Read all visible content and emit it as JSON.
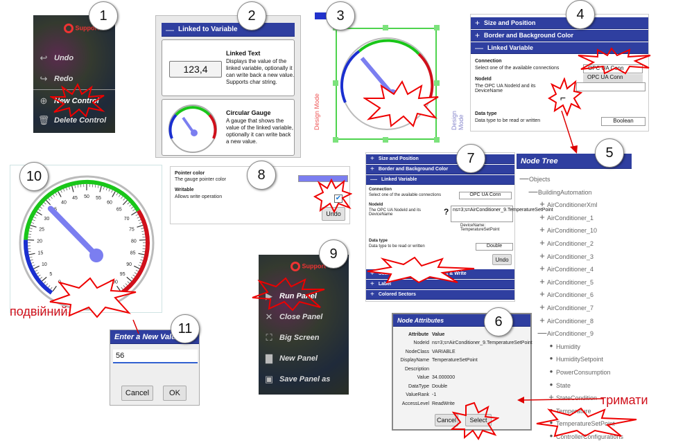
{
  "numbers": [
    "1",
    "2",
    "3",
    "4",
    "5",
    "6",
    "7",
    "8",
    "9",
    "10",
    "11"
  ],
  "panel1": {
    "logo": "Support",
    "items": [
      {
        "label": "Undo",
        "icon": "undo-icon"
      },
      {
        "label": "Redo",
        "icon": "redo-icon"
      },
      {
        "label": "New Control",
        "icon": "add-circle-icon"
      },
      {
        "label": "Delete Control",
        "icon": "trash-icon"
      }
    ]
  },
  "panel2": {
    "header": "Linked to Variable",
    "items": [
      {
        "title": "Linked Text",
        "value": "123,4",
        "desc": "Displays the value of the linked variable, optionally it can write back a new value. Supports char string."
      },
      {
        "title": "Circular Gauge",
        "desc": "A gauge that shows the value of the linked variable, optionally it can write back a new value."
      }
    ]
  },
  "panel3": {
    "side": "Design Mode"
  },
  "panel4": {
    "sections": [
      "Size and Position",
      "Border and Background Color",
      "Linked Variable"
    ],
    "connection_label": "Connection",
    "connection_desc": "Select one of the available connections",
    "connection_value": "OPC UA Conn",
    "connection_opt": "OPC UA Conn",
    "nodeid_label": "NodeId",
    "nodeid_desc": "The OPC UA NodeId and its DeviceName",
    "datatype_label": "Data type",
    "datatype_desc": "Data type to be read or written",
    "datatype_value": "Boolean"
  },
  "panel5": {
    "header": "Node Tree",
    "nodes": [
      "Objects",
      "BuildingAutomation",
      "AirConditionerXml",
      "AirConditioner_1",
      "AirConditioner_10",
      "AirConditioner_2",
      "AirConditioner_3",
      "AirConditioner_4",
      "AirConditioner_5",
      "AirConditioner_6",
      "AirConditioner_7",
      "AirConditioner_8",
      "AirConditioner_9",
      "Humidity",
      "HumiditySetpoint",
      "PowerConsumption",
      "State",
      "StateCondition",
      "Temperature",
      "TemperatureSetPoint",
      "ControllerConfigurations"
    ]
  },
  "panel6": {
    "header": "Node Attributes",
    "col_attr": "Attribute",
    "col_val": "Value",
    "rows": [
      [
        "NodeId",
        "ns=3;s=AirConditioner_9.TemperatureSetPoint"
      ],
      [
        "NodeClass",
        "VARIABLE"
      ],
      [
        "DisplayName",
        "TemperatureSetPoint"
      ],
      [
        "Description",
        ""
      ],
      [
        "Value",
        "34.000000"
      ],
      [
        "DataType",
        "Double"
      ],
      [
        "ValueRank",
        "-1"
      ],
      [
        "AccessLevel",
        "ReadWrite"
      ]
    ],
    "cancel": "Cancel",
    "select": "Select"
  },
  "panel7": {
    "sections": [
      "Size and Position",
      "Border and Background Color",
      "Linked Variable"
    ],
    "connection_label": "Connection",
    "connection_desc": "Select one of the available connections",
    "connection_value": "OPC UA Conn",
    "nodeid_label": "NodeId",
    "nodeid_desc": "The OPC UA NodeId and its DeviceName",
    "nodeid_value": "ns=3;s=AirConditioner_9.TemperatureSetPoint",
    "device_name": "DeviceName: TemperatureSetPoint",
    "datatype_label": "Data type",
    "datatype_desc": "Data type to be read or written",
    "datatype_value": "Double",
    "undo": "Undo",
    "bottom": [
      "Scale Limits, Duration, Aspect & Write",
      "Label",
      "Colored Sectors"
    ]
  },
  "panel8": {
    "pointer_title": "Pointer color",
    "pointer_desc": "The gauge pointer color",
    "writable_title": "Writable",
    "writable_desc": "Allows write operation",
    "undo": "Undo"
  },
  "panel9": {
    "logo": "Support",
    "items": [
      {
        "label": "Run Panel",
        "icon": "play-icon"
      },
      {
        "label": "Close Panel",
        "icon": "close-icon"
      },
      {
        "label": "Big Screen",
        "icon": "fullscreen-icon"
      },
      {
        "label": "New Panel",
        "icon": "document-icon"
      },
      {
        "label": "Save Panel as",
        "icon": "save-icon"
      }
    ]
  },
  "panel11": {
    "title": "Enter a New Value",
    "value": "56",
    "cancel": "Cancel",
    "ok": "OK"
  },
  "captions": {
    "double": "подвійний",
    "hold": "тримати"
  },
  "gauge_labels": [
    "0",
    "5",
    "10",
    "15",
    "20",
    "25",
    "30",
    "35",
    "40",
    "45",
    "50",
    "55",
    "60",
    "65",
    "70",
    "75",
    "80",
    "85",
    "90",
    "95",
    "100"
  ],
  "colors": {
    "bar": "#2f3fa0",
    "pointer": "#7b7ef0",
    "red": "#d0101b",
    "green": "#19c619",
    "blue": "#1a2fd0"
  }
}
